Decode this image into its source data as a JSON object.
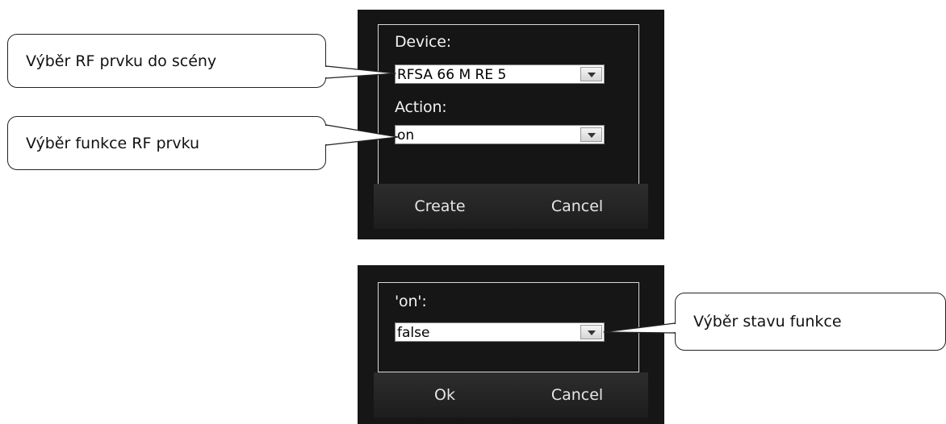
{
  "callouts": {
    "device": "Výběr RF prvku do scény",
    "function": "Výběr funkce RF prvku",
    "state": "Výběr stavu funkce"
  },
  "create_dialog": {
    "device_label": "Device:",
    "device_value": "RFSA 66 M RE 5",
    "action_label": "Action:",
    "action_value": "on",
    "create_button": "Create",
    "cancel_button": "Cancel"
  },
  "value_dialog": {
    "param_label": "'on':",
    "param_value": "false",
    "ok_button": "Ok",
    "cancel_button": "Cancel"
  },
  "icons": {
    "dropdown": "chevron-down-icon"
  },
  "colors": {
    "dialog_background": "#151515",
    "frame_border": "#d9d9d9",
    "callout_border": "#222222"
  }
}
